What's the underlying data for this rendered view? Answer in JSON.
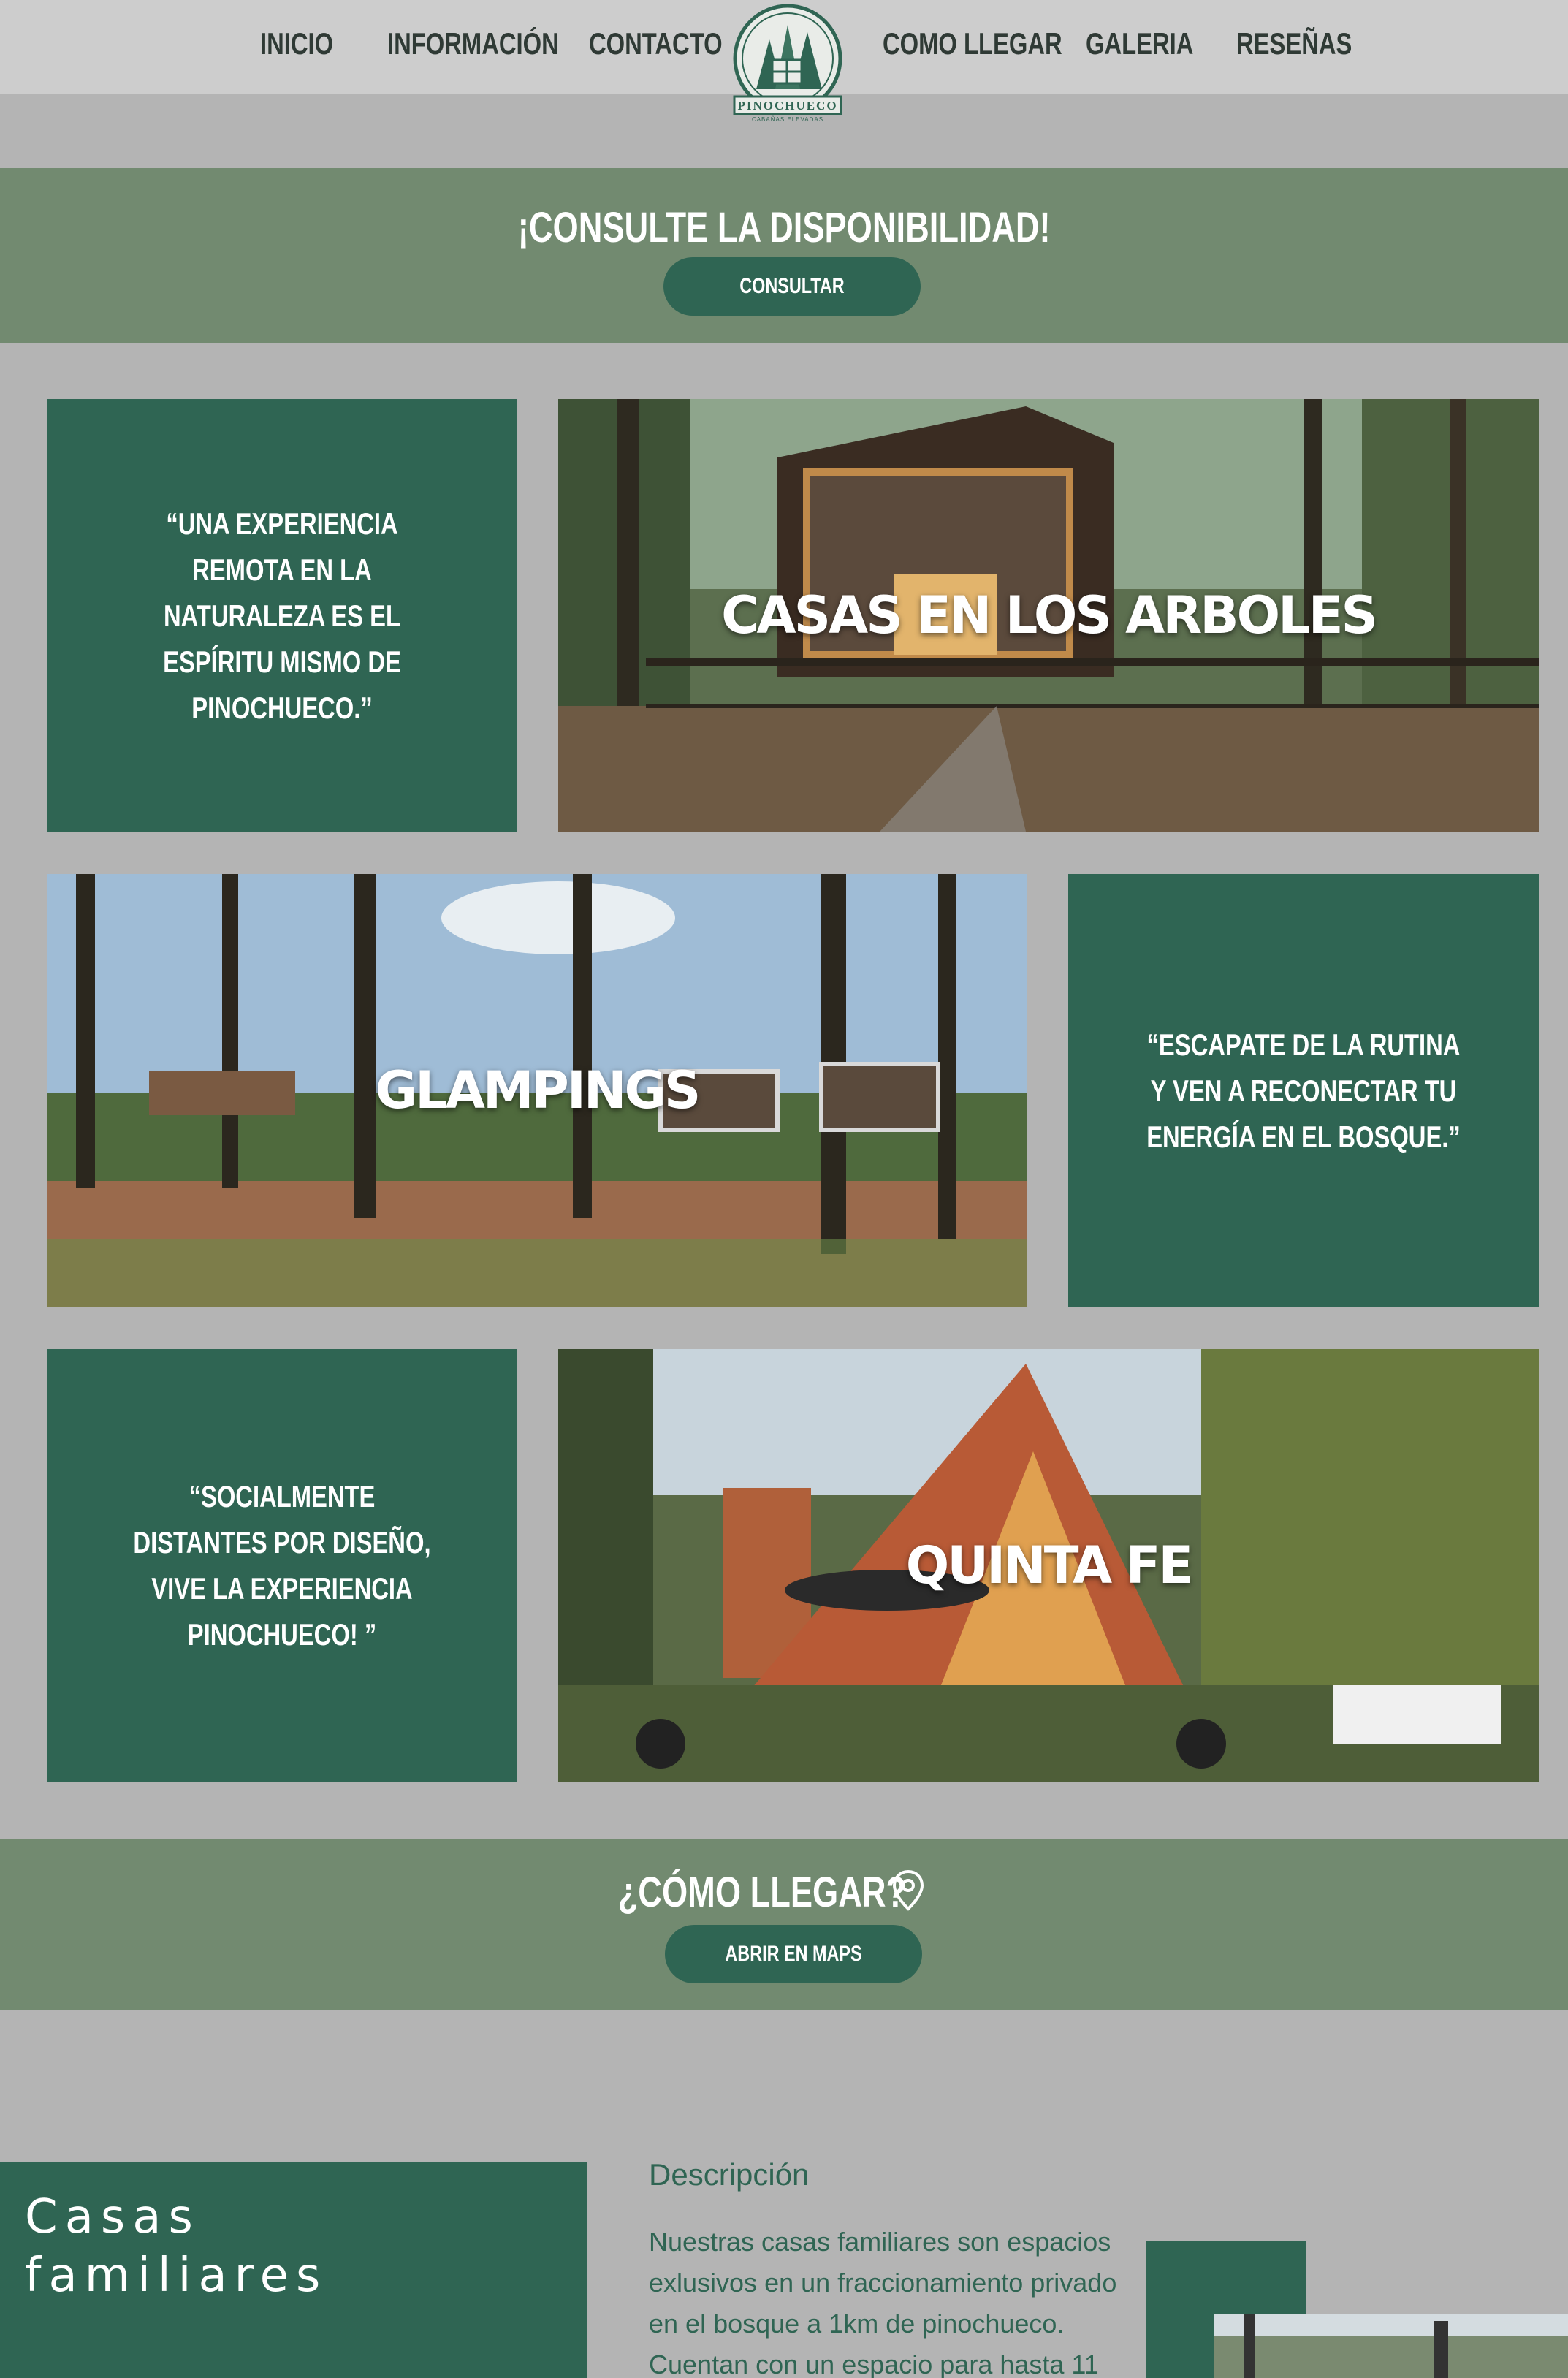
{
  "nav": {
    "items": [
      {
        "label": "INICIO"
      },
      {
        "label": "INFORMACIÓN"
      },
      {
        "label": "CONTACTO"
      },
      {
        "label": "COMO LLEGAR"
      },
      {
        "label": "GALERIA"
      },
      {
        "label": "RESEÑAS"
      }
    ],
    "logo": {
      "name": "PINOCHUECO",
      "tagline": "CABAÑAS ELEVADAS"
    }
  },
  "availability": {
    "title": "¡CONSULTE LA DISPONIBILIDAD!",
    "button": "CONSULTAR"
  },
  "grid": {
    "quote1": "“UNA EXPERIENCIA REMOTA EN LA NATURALEZA ES EL ESPÍRITU MISMO DE PINOCHUECO.”",
    "photo1": "CASAS EN LOS ARBOLES",
    "photo2": "GLAMPINGS",
    "quote2": "“ESCAPATE DE LA RUTINA Y VEN A RECONECTAR TU ENERGÍA EN EL BOSQUE.”",
    "quote3": "“SOCIALMENTE DISTANTES POR DISEÑO, VIVE LA EXPERIENCIA PINOCHUECO! ”",
    "photo3": "QUINTA FE"
  },
  "directions": {
    "title": "¿CÓMO LLEGAR?",
    "icon": "location-pin-icon",
    "button": "ABRIR EN MAPS"
  },
  "family": {
    "title_line1": "Casas",
    "title_line2": "familiares",
    "desc_heading": "Descripción",
    "desc_text": "Nuestras casas familiares son espacios exlusivos en un fraccionamiento privado en el bosque a 1km de pinochueco. Cuentan con un espacio para hasta 11"
  },
  "colors": {
    "page_bg": "#b4b4b4",
    "nav_bg": "#cdcdcd",
    "banner_bg": "#728a70",
    "brand_green": "#2f6553"
  }
}
